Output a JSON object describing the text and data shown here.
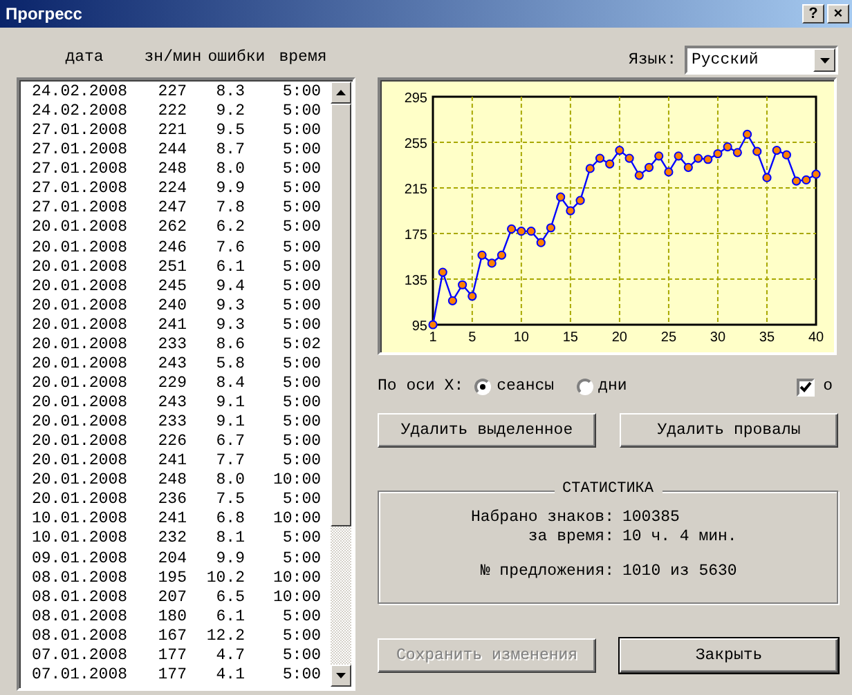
{
  "window": {
    "title": "Прогресс",
    "buttons": [
      "?",
      "×"
    ]
  },
  "table": {
    "columns": [
      "дата",
      "зн/мин",
      "ошибки",
      "время"
    ],
    "rows": [
      [
        "24.02.2008",
        "227",
        "8.3",
        "5:00"
      ],
      [
        "24.02.2008",
        "222",
        "9.2",
        "5:00"
      ],
      [
        "27.01.2008",
        "221",
        "9.5",
        "5:00"
      ],
      [
        "27.01.2008",
        "244",
        "8.7",
        "5:00"
      ],
      [
        "27.01.2008",
        "248",
        "8.0",
        "5:00"
      ],
      [
        "27.01.2008",
        "224",
        "9.9",
        "5:00"
      ],
      [
        "27.01.2008",
        "247",
        "7.8",
        "5:00"
      ],
      [
        "20.01.2008",
        "262",
        "6.2",
        "5:00"
      ],
      [
        "20.01.2008",
        "246",
        "7.6",
        "5:00"
      ],
      [
        "20.01.2008",
        "251",
        "6.1",
        "5:00"
      ],
      [
        "20.01.2008",
        "245",
        "9.4",
        "5:00"
      ],
      [
        "20.01.2008",
        "240",
        "9.3",
        "5:00"
      ],
      [
        "20.01.2008",
        "241",
        "9.3",
        "5:00"
      ],
      [
        "20.01.2008",
        "233",
        "8.6",
        "5:02"
      ],
      [
        "20.01.2008",
        "243",
        "5.8",
        "5:00"
      ],
      [
        "20.01.2008",
        "229",
        "8.4",
        "5:00"
      ],
      [
        "20.01.2008",
        "243",
        "9.1",
        "5:00"
      ],
      [
        "20.01.2008",
        "233",
        "9.1",
        "5:00"
      ],
      [
        "20.01.2008",
        "226",
        "6.7",
        "5:00"
      ],
      [
        "20.01.2008",
        "241",
        "7.7",
        "5:00"
      ],
      [
        "20.01.2008",
        "248",
        "8.0",
        "10:00"
      ],
      [
        "20.01.2008",
        "236",
        "7.5",
        "5:00"
      ],
      [
        "10.01.2008",
        "241",
        "6.8",
        "10:00"
      ],
      [
        "10.01.2008",
        "232",
        "8.1",
        "5:00"
      ],
      [
        "09.01.2008",
        "204",
        "9.9",
        "5:00"
      ],
      [
        "08.01.2008",
        "195",
        "10.2",
        "10:00"
      ],
      [
        "08.01.2008",
        "207",
        "6.5",
        "10:00"
      ],
      [
        "08.01.2008",
        "180",
        "6.1",
        "5:00"
      ],
      [
        "08.01.2008",
        "167",
        "12.2",
        "5:00"
      ],
      [
        "07.01.2008",
        "177",
        "4.7",
        "5:00"
      ],
      [
        "07.01.2008",
        "177",
        "4.1",
        "5:00"
      ]
    ]
  },
  "language": {
    "label": "Язык:",
    "value": "Русский"
  },
  "chart": {
    "chart_data": {
      "type": "line",
      "x": [
        1,
        2,
        3,
        4,
        5,
        6,
        7,
        8,
        9,
        10,
        11,
        12,
        13,
        14,
        15,
        16,
        17,
        18,
        19,
        20,
        21,
        22,
        23,
        24,
        25,
        26,
        27,
        28,
        29,
        30,
        31,
        32,
        33,
        34,
        35,
        36,
        37,
        38,
        39,
        40
      ],
      "grid": true,
      "series": [
        {
          "color": "#0000ff",
          "marker": "circle",
          "values": [
            95,
            141,
            116,
            130,
            120,
            156,
            149,
            156,
            179,
            177,
            177,
            167,
            180,
            207,
            195,
            204,
            232,
            241,
            236,
            248,
            241,
            226,
            233,
            243,
            229,
            243,
            233,
            241,
            240,
            245,
            251,
            246,
            262,
            247,
            224,
            248,
            244,
            221,
            222,
            227
          ]
        }
      ],
      "xlim": [
        1,
        40
      ],
      "ylim": [
        95,
        295
      ],
      "xticks": [
        1,
        5,
        10,
        15,
        20,
        25,
        30,
        35,
        40
      ],
      "yticks": [
        95,
        135,
        175,
        215,
        255,
        295
      ]
    }
  },
  "x_axis": {
    "label": "По оси X:",
    "options": [
      {
        "label": "сеансы",
        "selected": true
      },
      {
        "label": "дни",
        "selected": false
      }
    ]
  },
  "marker_checkbox": {
    "label": "о",
    "checked": true
  },
  "action_buttons": [
    {
      "label": "Удалить выделенное",
      "disabled": false
    },
    {
      "label": "Удалить провалы",
      "disabled": false
    }
  ],
  "statistics": {
    "title": "СТАТИСТИКА",
    "groups": [
      [
        {
          "label": "Набрано знаков:",
          "value": "100385"
        },
        {
          "label": "за время:",
          "value": "10 ч. 4 мин."
        }
      ],
      [
        {
          "label": "№ предложения:",
          "value": "1010 из 5630"
        }
      ]
    ]
  },
  "footer_buttons": [
    {
      "label": "Сохранить изменения",
      "disabled": true,
      "default": false
    },
    {
      "label": "Закрыть",
      "disabled": false,
      "default": true
    }
  ]
}
